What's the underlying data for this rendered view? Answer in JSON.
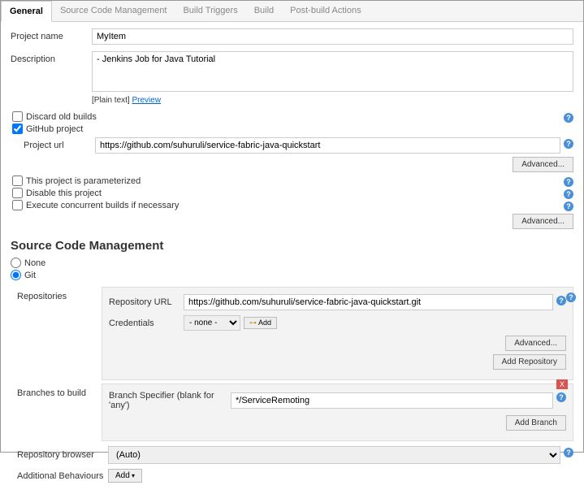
{
  "tabs": {
    "general": "General",
    "scm": "Source Code Management",
    "build_triggers": "Build Triggers",
    "build": "Build",
    "post_build": "Post-build Actions"
  },
  "general": {
    "project_name_label": "Project name",
    "project_name_value": "MyItem",
    "description_label": "Description",
    "description_value": "- Jenkins Job for Java Tutorial",
    "plain_text": "[Plain text]",
    "preview": "Preview",
    "discard_old_builds": "Discard old builds",
    "github_project": "GitHub project",
    "project_url_label": "Project url",
    "project_url_value": "https://github.com/suhuruli/service-fabric-java-quickstart",
    "advanced": "Advanced...",
    "parameterized": "This project is parameterized",
    "disable_project": "Disable this project",
    "concurrent": "Execute concurrent builds if necessary"
  },
  "scm_section": {
    "title": "Source Code Management",
    "none": "None",
    "git": "Git",
    "repositories_label": "Repositories",
    "repo_url_label": "Repository URL",
    "repo_url_value": "https://github.com/suhuruli/service-fabric-java-quickstart.git",
    "credentials_label": "Credentials",
    "credentials_value": "- none -",
    "add_cred": "Add",
    "advanced": "Advanced...",
    "add_repository": "Add Repository",
    "branches_label": "Branches to build",
    "branch_spec_label": "Branch Specifier (blank for 'any')",
    "branch_spec_value": "*/ServiceRemoting",
    "add_branch": "Add Branch",
    "delete": "X",
    "repo_browser_label": "Repository browser",
    "repo_browser_value": "(Auto)",
    "additional_label": "Additional Behaviours",
    "add": "Add"
  }
}
